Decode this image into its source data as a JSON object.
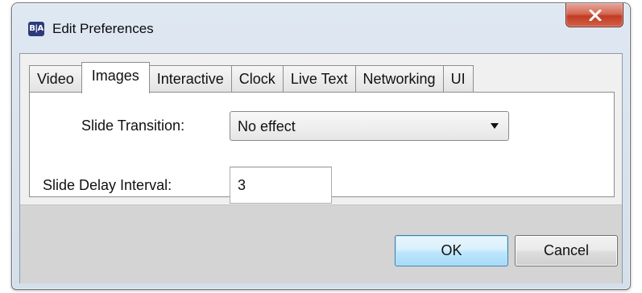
{
  "window": {
    "title": "Edit Preferences",
    "app_icon": "B|A"
  },
  "tabs": [
    {
      "label": "Video",
      "active": false
    },
    {
      "label": "Images",
      "active": true
    },
    {
      "label": "Interactive",
      "active": false
    },
    {
      "label": "Clock",
      "active": false
    },
    {
      "label": "Live Text",
      "active": false
    },
    {
      "label": "Networking",
      "active": false
    },
    {
      "label": "UI",
      "active": false
    }
  ],
  "form": {
    "slide_transition_label": "Slide Transition:",
    "slide_transition_value": "No effect",
    "slide_delay_label": "Slide Delay Interval:",
    "slide_delay_value": "3"
  },
  "buttons": {
    "ok": "OK",
    "cancel": "Cancel"
  },
  "icons": {
    "close": "close-icon",
    "dropdown": "chevron-down-icon"
  },
  "colors": {
    "close_button": "#c23b22",
    "ok_button_border": "#3c7fb1",
    "footer": "#d4d4d4"
  }
}
